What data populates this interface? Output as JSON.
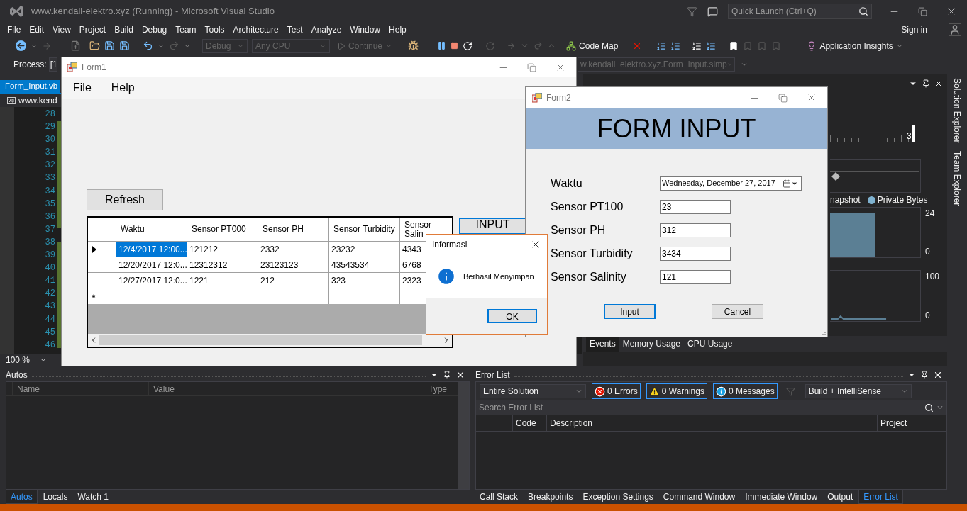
{
  "ide": {
    "title": "www.kendali-elektro.xyz (Running) - Microsoft Visual Studio",
    "quick_launch": {
      "placeholder": "Quick Launch (Ctrl+Q)"
    },
    "menu": [
      "File",
      "Edit",
      "View",
      "Project",
      "Build",
      "Debug",
      "Team",
      "Tools",
      "Architecture",
      "Test",
      "Analyze",
      "Window",
      "Help"
    ],
    "sign_in": "Sign in",
    "toolbar": {
      "configuration": "Debug",
      "platform": "Any CPU",
      "continue": "Continue",
      "code_map": "Code Map",
      "insights": "Application Insights"
    },
    "process": {
      "label": "Process:",
      "value": "[1"
    },
    "startup_object": "w.kendali_elektro.xyz.Form_Input.simp"
  },
  "editor": {
    "tab": {
      "label": "Form_Input.vb",
      "selected": true
    },
    "nav": "www.kend",
    "line_numbers": [
      "28",
      "29",
      "30",
      "31",
      "32",
      "33",
      "34",
      "35",
      "36",
      "37",
      "38",
      "39",
      "40",
      "41",
      "42",
      "43",
      "44",
      "45",
      "46"
    ],
    "zoom": "100 %"
  },
  "diagnostics": {
    "ruler_mark": "3",
    "legend": [
      {
        "label": "napshot",
        "kind": "text"
      },
      {
        "label": "Private Bytes",
        "kind": "dot",
        "color": "#7fb2d0"
      }
    ],
    "memory_axis": [
      "24",
      "0"
    ],
    "cpu_axis": [
      "100",
      "0"
    ],
    "tabs": [
      {
        "label": "Events",
        "selected": true
      },
      {
        "label": "Memory Usage",
        "selected": false
      },
      {
        "label": "CPU Usage",
        "selected": false
      }
    ]
  },
  "side_tabs": [
    "Solution Explorer",
    "Team Explorer"
  ],
  "autos": {
    "title": "Autos",
    "columns": [
      "Name",
      "Value",
      "Type"
    ],
    "tabs": [
      {
        "label": "Autos",
        "selected": true
      },
      {
        "label": "Locals",
        "selected": false
      },
      {
        "label": "Watch 1",
        "selected": false
      }
    ]
  },
  "error_list": {
    "title": "Error List",
    "scope": "Entire Solution",
    "filters": [
      {
        "label": "0 Errors",
        "kind": "error",
        "on": true
      },
      {
        "label": "0 Warnings",
        "kind": "warning",
        "on": true
      },
      {
        "label": "0 Messages",
        "kind": "info",
        "on": true
      }
    ],
    "source": "Build + IntelliSense",
    "search": {
      "placeholder": "Search Error List"
    },
    "columns": [
      "Code",
      "Description",
      "Project"
    ],
    "tabs": [
      {
        "label": "Call Stack",
        "selected": false
      },
      {
        "label": "Breakpoints",
        "selected": false
      },
      {
        "label": "Exception Settings",
        "selected": false
      },
      {
        "label": "Command Window",
        "selected": false
      },
      {
        "label": "Immediate Window",
        "selected": false
      },
      {
        "label": "Output",
        "selected": false
      },
      {
        "label": "Error List",
        "selected": true
      }
    ]
  },
  "form1": {
    "title": "Form1",
    "menu": [
      "File",
      "Help"
    ],
    "refresh": "Refresh",
    "input_button": "INPUT",
    "grid": {
      "columns": [
        "Waktu",
        "Sensor PT000",
        "Sensor PH",
        "Sensor Turbidity",
        "Sensor Salin"
      ],
      "rows": [
        {
          "current": true,
          "selected": true,
          "cells": [
            "12/4/2017 12:00...",
            "121212",
            "2332",
            "23232",
            "4343"
          ]
        },
        {
          "current": false,
          "selected": false,
          "cells": [
            "12/20/2017 12:0...",
            "12312312",
            "23123123",
            "43543534",
            "6768"
          ]
        },
        {
          "current": false,
          "selected": false,
          "cells": [
            "12/27/2017 12:0...",
            "1221",
            "212",
            "323",
            "2323"
          ]
        }
      ]
    }
  },
  "form2": {
    "title": "Form2",
    "heading": "FORM INPUT",
    "fields": [
      {
        "label": "Waktu",
        "kind": "date",
        "value": "Wednesday, December 27, 2017"
      },
      {
        "label": "Sensor PT100",
        "kind": "text",
        "value": "23"
      },
      {
        "label": "Sensor PH",
        "kind": "text",
        "value": "312"
      },
      {
        "label": "Sensor Turbidity",
        "kind": "text",
        "value": "3434"
      },
      {
        "label": "Sensor Salinity",
        "kind": "text",
        "value": "121"
      }
    ],
    "buttons": [
      {
        "label": "Input",
        "default": true
      },
      {
        "label": "Cancel",
        "default": false
      }
    ]
  },
  "dialog": {
    "title": "Informasi",
    "message": "Berhasil Menyimpan",
    "button": "OK"
  }
}
